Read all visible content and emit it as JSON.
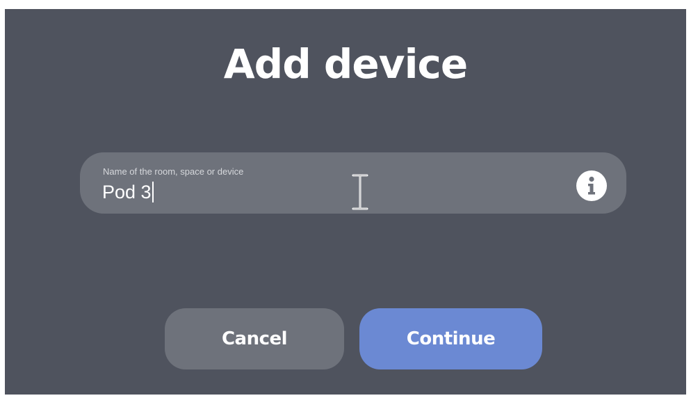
{
  "dialog": {
    "title": "Add device",
    "name_field": {
      "label": "Name of the room, space or device",
      "value": "Pod 3"
    },
    "buttons": {
      "cancel_label": "Cancel",
      "continue_label": "Continue"
    }
  },
  "icons": {
    "info": "info-icon",
    "cursor": "text-cursor-icon"
  },
  "colors": {
    "background": "#4f535e",
    "field": "#6e727b",
    "cancel_button": "#6e727b",
    "continue_button": "#6b89d3",
    "text": "#ffffff"
  }
}
